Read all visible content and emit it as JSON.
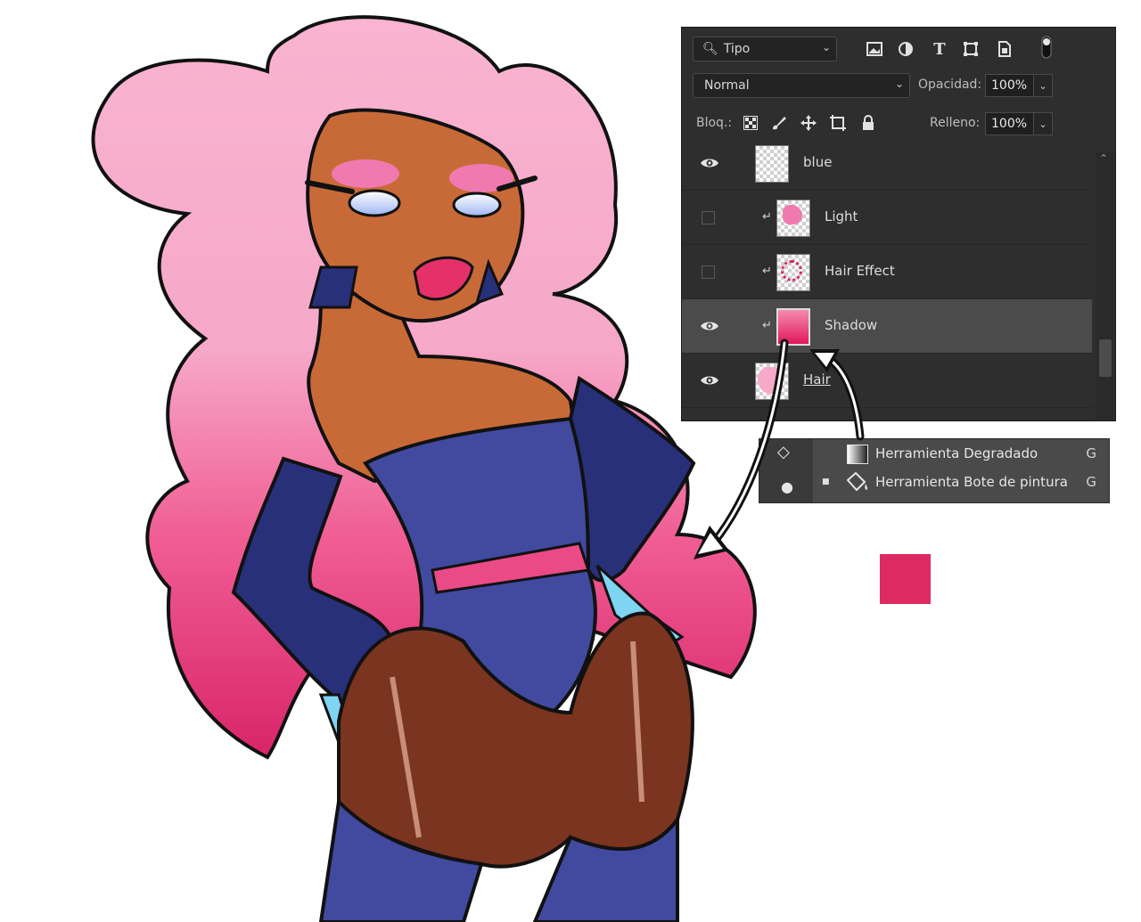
{
  "layers_panel": {
    "filter_label": "Tipo",
    "blend_mode": "Normal",
    "opacity_label": "Opacidad:",
    "opacity_value": "100%",
    "lock_label": "Bloq.:",
    "fill_label": "Relleno:",
    "fill_value": "100%",
    "layers": [
      {
        "name": "blue",
        "visible": true,
        "clipped": false,
        "selected": false
      },
      {
        "name": "Light",
        "visible": false,
        "clipped": true,
        "selected": false
      },
      {
        "name": "Hair Effect",
        "visible": false,
        "clipped": true,
        "selected": false
      },
      {
        "name": "Shadow",
        "visible": true,
        "clipped": true,
        "selected": true
      },
      {
        "name": "Hair",
        "visible": true,
        "clipped": false,
        "selected": false
      }
    ]
  },
  "tool_flyout": {
    "items": [
      {
        "name": "Herramienta Degradado",
        "shortcut": "G",
        "active": false
      },
      {
        "name": "Herramienta Bote de pintura",
        "shortcut": "G",
        "active": true
      }
    ]
  },
  "colors": {
    "swatch": "#dc2b63",
    "hair_top": "#f7b3cf",
    "hair_bottom": "#e0306d",
    "skin": "#c86a37",
    "outfit": "#414a9f",
    "gloves": "#28307a",
    "belt": "#ea4a85",
    "stockings": "#7a3420"
  }
}
